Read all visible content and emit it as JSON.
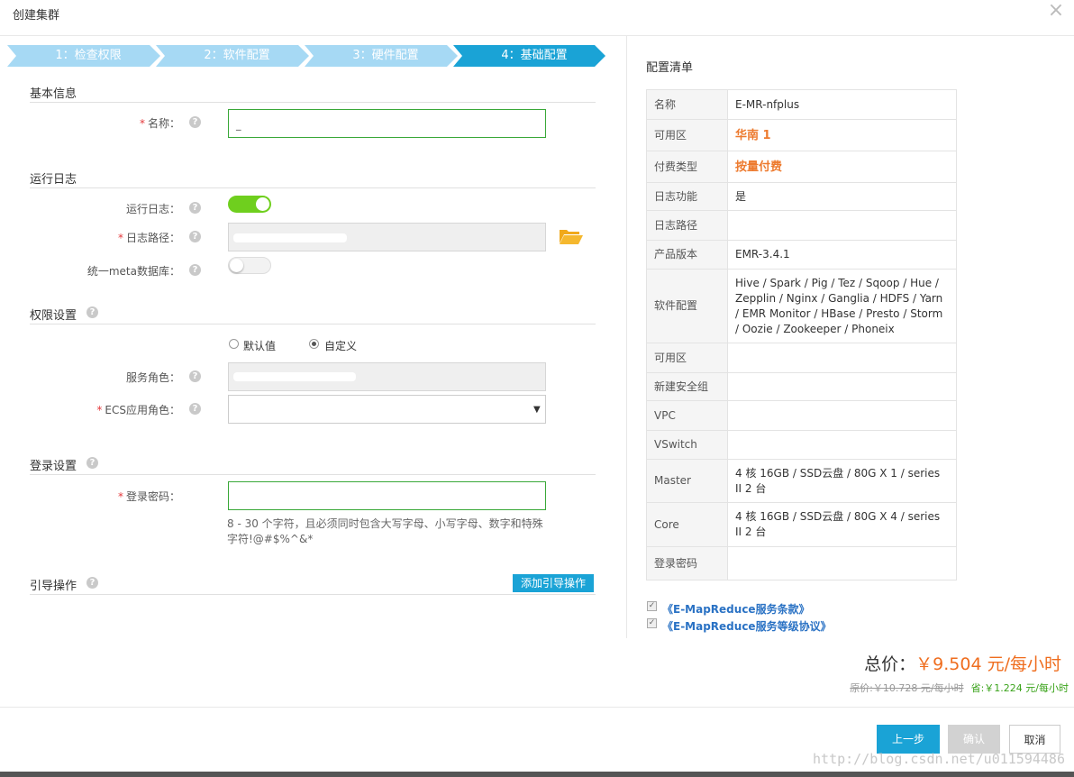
{
  "dialog": {
    "title": "创建集群"
  },
  "steps": [
    {
      "label": "1：检查权限"
    },
    {
      "label": "2：软件配置"
    },
    {
      "label": "3：硬件配置"
    },
    {
      "label": "4：基础配置"
    }
  ],
  "basic": {
    "section": "基本信息",
    "name_label": "名称：",
    "name_value": "E-MR-nfplus"
  },
  "log": {
    "section": "运行日志",
    "run_log_label": "运行日志：",
    "run_log_on": true,
    "log_path_label": "日志路径：",
    "meta_label": "统一meta数据库：",
    "meta_on": false
  },
  "perm": {
    "section": "权限设置",
    "radio_default": "默认值",
    "radio_custom": "自定义",
    "selected": "自定义",
    "service_role_label": "服务角色：",
    "ecs_role_label": "ECS应用角色："
  },
  "login": {
    "section": "登录设置",
    "password_label": "登录密码：",
    "hint": "8 - 30 个字符，且必须同时包含大写字母、小写字母、数字和特殊字符!@#$%^&*"
  },
  "guide": {
    "section": "引导操作",
    "add_button": "添加引导操作"
  },
  "summary": {
    "title": "配置清单",
    "rows": [
      {
        "k": "名称",
        "v": "E-MR-nfplus"
      },
      {
        "k": "可用区",
        "v": "华南 1"
      },
      {
        "k": "付费类型",
        "v": "按量付费"
      },
      {
        "k": "日志功能",
        "v": "是"
      },
      {
        "k": "日志路径",
        "v": ""
      },
      {
        "k": "产品版本",
        "v": "EMR-3.4.1"
      },
      {
        "k": "软件配置",
        "v": "Hive / Spark / Pig / Tez / Sqoop / Hue / Zepplin / Nginx / Ganglia / HDFS / Yarn / EMR Monitor / HBase / Presto / Storm / Oozie / Zookeeper / Phoneix"
      },
      {
        "k": "可用区",
        "v": ""
      },
      {
        "k": "新建安全组",
        "v": ""
      },
      {
        "k": "VPC",
        "v": ""
      },
      {
        "k": "VSwitch",
        "v": ""
      },
      {
        "k": "Master",
        "v": "4 核 16GB / SSD云盘 / 80G X 1 / series II 2 台"
      },
      {
        "k": "Core",
        "v": "4 核 16GB / SSD云盘 / 80G X 4 / series II 2 台"
      },
      {
        "k": "登录密码",
        "v": ""
      }
    ]
  },
  "agreements": [
    "《E-MapReduce服务条款》",
    "《E-MapReduce服务等级协议》"
  ],
  "price": {
    "total_label": "总价：",
    "total_value": "￥9.504 元/每小时",
    "original": "原价:￥10.728 元/每小时",
    "saved": "省:￥1.224 元/每小时"
  },
  "footer": {
    "prev": "上一步",
    "ok": "确认",
    "cancel": "取消"
  },
  "watermark": "http://blog.csdn.net/u011594486",
  "colors": {
    "accent": "#1aa3d6",
    "step_done": "#a6d9f4",
    "toggle_on": "#6fcf1e",
    "price": "#ef6d1e",
    "saved": "#3aa31a",
    "link": "#2a72c4"
  }
}
